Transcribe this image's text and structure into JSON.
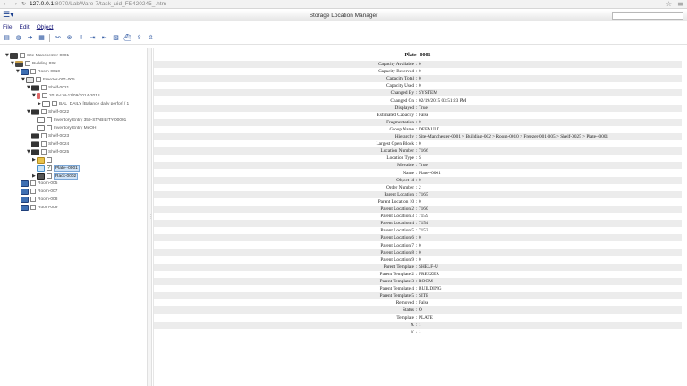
{
  "browser": {
    "url_host": "127.0.0.1",
    "url_path": ":8070/LabWare-7/task_uid_FE420245_.htm"
  },
  "app": {
    "title": "Storage Location Manager"
  },
  "menu": {
    "items": [
      "File",
      "Edit",
      "Object"
    ]
  },
  "tree": {
    "items": [
      {
        "label": "Site-Manchester-0001",
        "icon": "site",
        "depth": 0,
        "twisty": "▼"
      },
      {
        "label": "Building-002",
        "icon": "building",
        "depth": 1,
        "twisty": "▼"
      },
      {
        "label": "Room-0010",
        "icon": "room",
        "depth": 2,
        "twisty": "▼"
      },
      {
        "label": "Freezer-001-005",
        "icon": "freezer",
        "depth": 3,
        "twisty": "▼"
      },
      {
        "label": "Shelf-0021",
        "icon": "shelf",
        "depth": 4,
        "twisty": "▼"
      },
      {
        "label": "2016-LW-11/09/2014-2018",
        "icon": "tube",
        "depth": 5,
        "twisty": "▼"
      },
      {
        "label": "BAL_DAILY [Balance daily perfor] / 1",
        "icon": "box",
        "depth": 6,
        "twisty": "▶"
      },
      {
        "label": "Shelf-0022",
        "icon": "shelf",
        "depth": 4,
        "twisty": "▼"
      },
      {
        "label": "Inventory Entry 359-STABILITY-00001",
        "icon": "box",
        "depth": 5,
        "twisty": ""
      },
      {
        "label": "Inventory Entry MeOH",
        "icon": "box",
        "depth": 5,
        "twisty": ""
      },
      {
        "label": "Shelf-0023",
        "icon": "shelf",
        "depth": 4,
        "twisty": ""
      },
      {
        "label": "Shelf-0024",
        "icon": "shelf",
        "depth": 4,
        "twisty": ""
      },
      {
        "label": "Shelf-0025",
        "icon": "shelf",
        "depth": 4,
        "twisty": "▼"
      },
      {
        "label": "",
        "icon": "folder",
        "depth": 5,
        "twisty": "▶"
      },
      {
        "label": "Plate--0001",
        "icon": "plate",
        "depth": 5,
        "twisty": "",
        "checked": true,
        "selected": true
      },
      {
        "label": "Rack-0002",
        "icon": "rack",
        "depth": 5,
        "twisty": "▶",
        "selected_outline": true
      },
      {
        "label": "Room-005",
        "icon": "room",
        "depth": 2,
        "twisty": ""
      },
      {
        "label": "Room-007",
        "icon": "room",
        "depth": 2,
        "twisty": ""
      },
      {
        "label": "Room-008",
        "icon": "room",
        "depth": 2,
        "twisty": ""
      },
      {
        "label": "Room-009",
        "icon": "room",
        "depth": 2,
        "twisty": ""
      }
    ]
  },
  "detail": {
    "header": "Plate--0001",
    "rows": [
      {
        "key": "Capacity Available",
        "value": "0"
      },
      {
        "key": "Capacity Reserved",
        "value": "0"
      },
      {
        "key": "Capacity Total",
        "value": "0"
      },
      {
        "key": "Capacity Used",
        "value": "0"
      },
      {
        "key": "Changed By",
        "value": "SYSTEM"
      },
      {
        "key": "Changed On",
        "value": "02/19/2015 03:51:23 PM"
      },
      {
        "key": "Displayed",
        "value": "True"
      },
      {
        "key": "Estimated Capacity",
        "value": "False"
      },
      {
        "key": "Fragmentation",
        "value": "0"
      },
      {
        "key": "Group Name",
        "value": "DEFAULT"
      },
      {
        "key": "Hierarchy",
        "value": "Site-Manchester-0001 > Building-002 > Room-0010 > Freezer-001-005 > Shelf-0025 > Plate--0001"
      },
      {
        "key": "Largest Open Block",
        "value": "0"
      },
      {
        "key": "Location Number",
        "value": "7166"
      },
      {
        "key": "Location Type",
        "value": "S"
      },
      {
        "key": "Movable",
        "value": "True"
      },
      {
        "key": "Name",
        "value": "Plate--0001"
      },
      {
        "key": "Object Id",
        "value": "0"
      },
      {
        "key": "Order Number",
        "value": "2"
      },
      {
        "key": "Parent Location",
        "value": "7165"
      },
      {
        "key": "Parent Location 10",
        "value": "0"
      },
      {
        "key": "Parent Location 2",
        "value": "7160"
      },
      {
        "key": "Parent Location 3",
        "value": "7159"
      },
      {
        "key": "Parent Location 4",
        "value": "7154"
      },
      {
        "key": "Parent Location 5",
        "value": "7153"
      },
      {
        "key": "Parent Location 6",
        "value": "0"
      },
      {
        "key": "Parent Location 7",
        "value": "0"
      },
      {
        "key": "Parent Location 8",
        "value": "0"
      },
      {
        "key": "Parent Location 9",
        "value": "0"
      },
      {
        "key": "Parent Template",
        "value": "SHELF-U"
      },
      {
        "key": "Parent Template 2",
        "value": "FREEZER"
      },
      {
        "key": "Parent Template 3",
        "value": "ROOM"
      },
      {
        "key": "Parent Template 4",
        "value": "BUILDING"
      },
      {
        "key": "Parent Template 5",
        "value": "SITE"
      },
      {
        "key": "Removed",
        "value": "False"
      },
      {
        "key": "Status",
        "value": "O"
      },
      {
        "key": "Template",
        "value": "PLATE"
      },
      {
        "key": "X",
        "value": "1"
      },
      {
        "key": "Y",
        "value": "1"
      }
    ]
  }
}
